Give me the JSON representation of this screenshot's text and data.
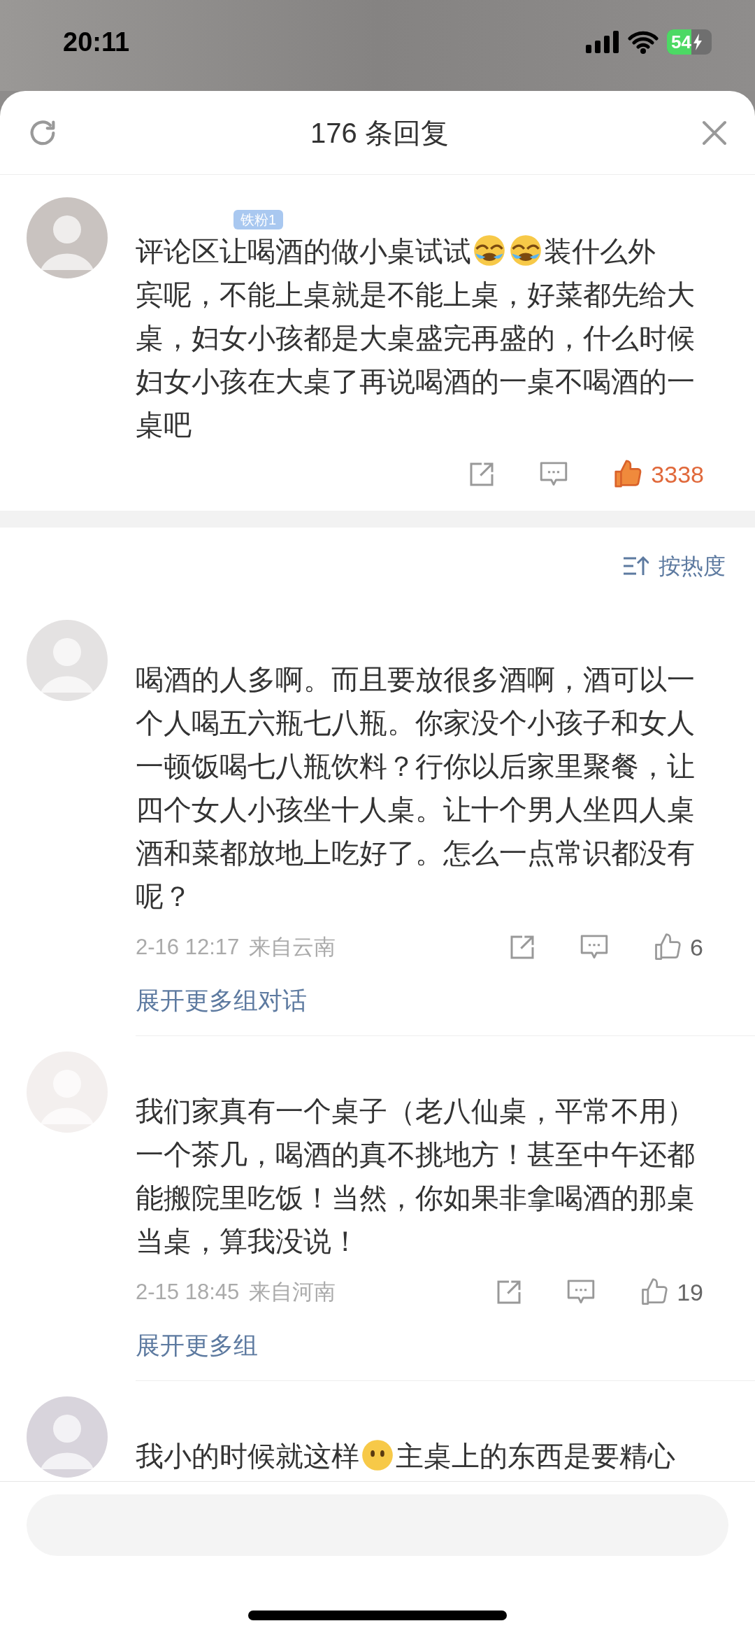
{
  "status_bar": {
    "time": "20:11",
    "battery": "54",
    "charging": true
  },
  "header": {
    "title": "176 条回复"
  },
  "main_comment": {
    "badge": "铁粉1",
    "content": [
      {
        "kind": "inline",
        "text": "评论区让喝酒的做小桌试试"
      },
      {
        "kind": "emoji"
      },
      {
        "kind": "emoji"
      },
      {
        "kind": "inline",
        "text": "装什么外"
      },
      {
        "kind": "text",
        "text": "宾呢，不能上桌就是不能上桌，好菜都先给大桌，妇女小孩都是大桌盛完再盛的，什么时候妇女小孩在大桌了再说喝酒的一桌不喝酒的一桌吧"
      }
    ],
    "likes": "3338",
    "liked": true
  },
  "sort": {
    "label": "按热度"
  },
  "replies": [
    {
      "content": [
        {
          "kind": "text",
          "text": "喝酒的人多啊。而且要放很多酒啊，酒可以一个人喝五六瓶七八瓶。你家没个小孩子和女人一顿饭喝七八瓶饮料？行你以后家里聚餐，让四个女人小孩坐十人桌。让十个男人坐四人桌酒和菜都放地上吃好了。怎么一点常识都没有呢？"
        }
      ],
      "date": "2-16 12:17",
      "location": "来自云南",
      "likes": "6",
      "liked": false,
      "expand": "展开更多组对话"
    },
    {
      "content": [
        {
          "kind": "text",
          "text": "我们家真有一个桌子（老八仙桌，平常不用）一个茶几，喝酒的真不挑地方！甚至中午还都能搬院里吃饭！当然，你如果非拿喝酒的那桌当桌，算我没说！"
        }
      ],
      "date": "2-15 18:45",
      "location": "来自河南",
      "likes": "19",
      "liked": false,
      "expand": "展开更多组"
    },
    {
      "content": [
        {
          "kind": "inline",
          "text": "我小的时候就这样"
        },
        {
          "kind": "emoji_blank"
        },
        {
          "kind": "inline",
          "text": "主桌上的东西是要精心"
        }
      ]
    }
  ]
}
